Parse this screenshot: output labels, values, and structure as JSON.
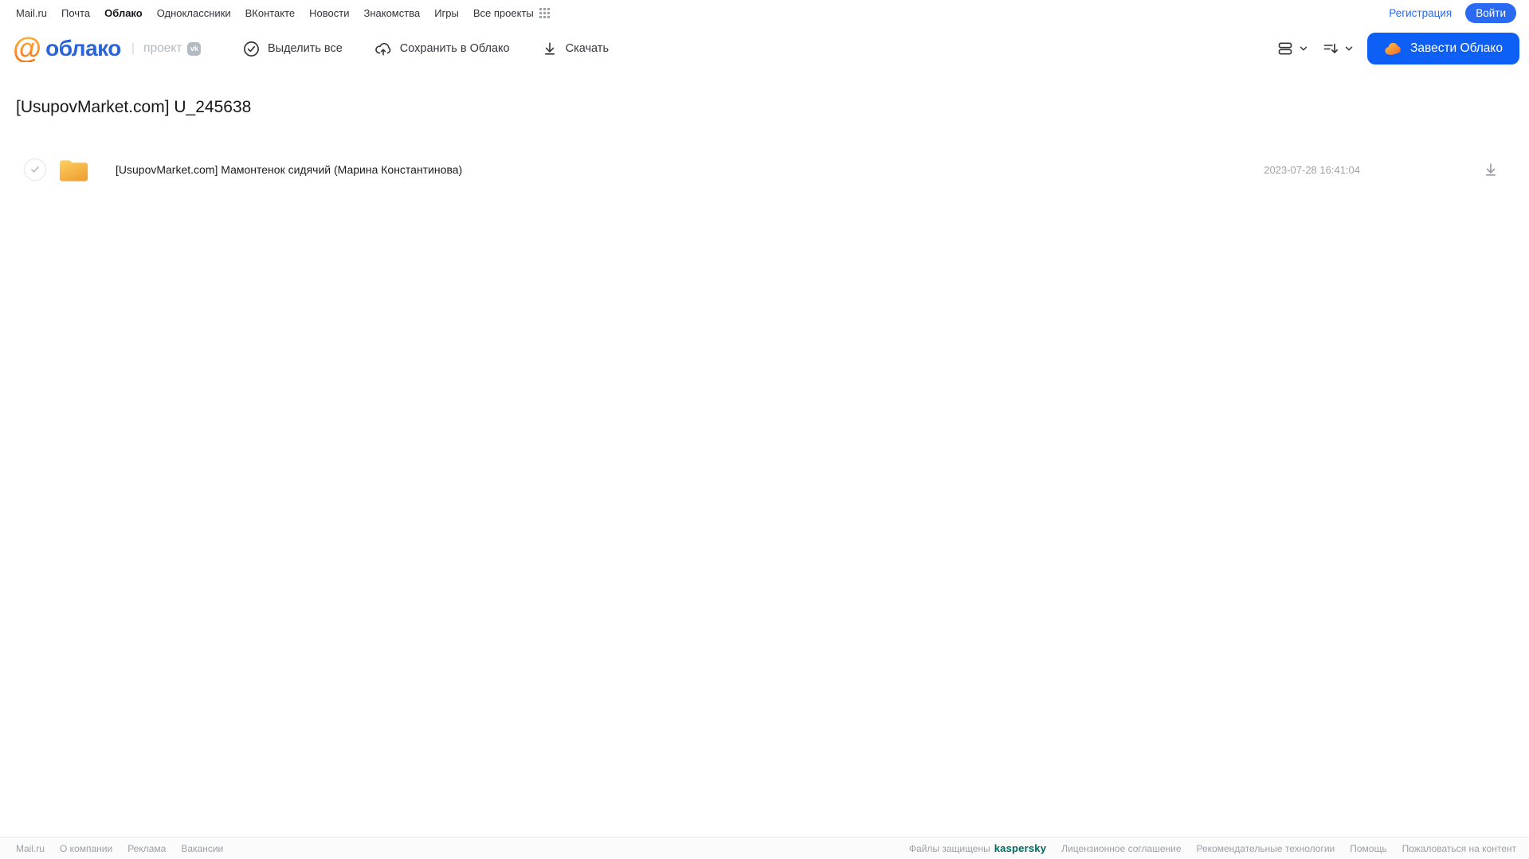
{
  "colors": {
    "accent": "#2a6af3",
    "accent_bright": "#0d5ff6",
    "logo_blue": "#2b63d9",
    "kaspersky_green": "#00695c",
    "folder_top": "#ffd062",
    "folder_bottom": "#efa236",
    "cloud_glyph_light": "#ffc544",
    "cloud_glyph_dark": "#f3652a"
  },
  "topnav": {
    "links": [
      "Mail.ru",
      "Почта",
      "Облако",
      "Одноклассники",
      "ВКонтакте",
      "Новости",
      "Знакомства",
      "Игры",
      "Все проекты"
    ],
    "registration": "Регистрация",
    "login": "Войти"
  },
  "header": {
    "logo_at": "@",
    "logo_text": "облако",
    "logo_divider": "|",
    "project_label": "проект",
    "vk_badge": "vk",
    "toolbar": {
      "select_all": "Выделить все",
      "save_to_cloud": "Сохранить в Облако",
      "download": "Скачать"
    },
    "get_cloud_button": "Завести Облако"
  },
  "main": {
    "title": "[UsupovMarket.com] U_245638",
    "files": [
      {
        "type": "folder",
        "name": "[UsupovMarket.com] Мамонтенок сидячий (Марина Константинова)",
        "modified": "2023-07-28 16:41:04"
      }
    ]
  },
  "footer": {
    "left_links": [
      "Mail.ru",
      "О компании",
      "Реклама",
      "Вакансии"
    ],
    "protected_label": "Файлы защищены",
    "kaspersky": "kaspersky",
    "right_links": [
      "Лицензионное соглашение",
      "Рекомендательные технологии",
      "Помощь",
      "Пожаловаться на контент"
    ]
  }
}
